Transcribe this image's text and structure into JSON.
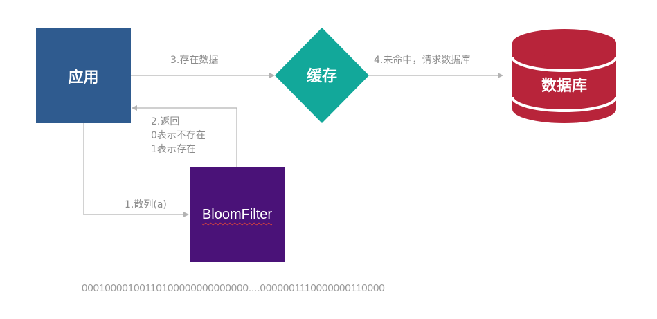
{
  "nodes": {
    "app": "应用",
    "cache": "缓存",
    "database": "数据库",
    "bloom_filter": "BloomFilter"
  },
  "edges": {
    "hash": "1.散列(a)",
    "return_title": "2.返回",
    "return_zero": "0表示不存在",
    "return_one": "1表示存在",
    "store": "3.存在数据",
    "miss": "4.未命中，请求数据库"
  },
  "bit_array": "00010000100110100000000000000....0000001110000000110000",
  "colors": {
    "app": "#2f5b8f",
    "cache": "#12a89a",
    "database": "#b8243a",
    "bloom_filter": "#4a1278",
    "arrow": "#b3b3b3"
  }
}
